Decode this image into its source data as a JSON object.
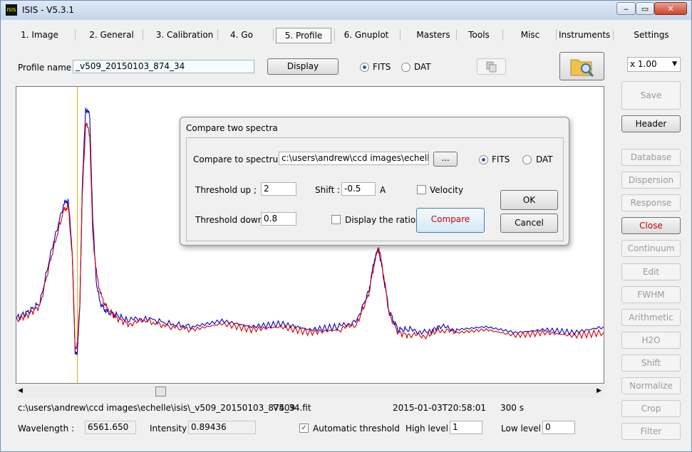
{
  "window": {
    "title": "ISIS - V5.3.1",
    "icon": "isis-app-icon",
    "icon_text": "ISIS",
    "minimize": "‒",
    "maximize": "▭",
    "close": "✕"
  },
  "tabs": [
    {
      "label": "1. Image"
    },
    {
      "label": "2. General"
    },
    {
      "label": "3. Calibration"
    },
    {
      "label": "4. Go"
    },
    {
      "label": "5. Profile"
    },
    {
      "label": "6. Gnuplot"
    },
    {
      "label": "Masters"
    },
    {
      "label": "Tools"
    },
    {
      "label": "Misc"
    },
    {
      "label": "Instruments"
    },
    {
      "label": "Settings"
    }
  ],
  "active_tab": "5. Profile",
  "profile": {
    "label": "Profile name :",
    "value": "_v509_20150103_874_34",
    "display_button": "Display",
    "fits_label": "FITS",
    "dat_label": "DAT",
    "format_selected": "FITS"
  },
  "zoom": {
    "value": "x 1.00",
    "arrow": "▼"
  },
  "right_buttons": [
    {
      "label": "Save",
      "enabled": false
    },
    {
      "label": "Header",
      "enabled": true
    },
    {
      "label": "Database",
      "enabled": false
    },
    {
      "label": "Dispersion",
      "enabled": false
    },
    {
      "label": "Response",
      "enabled": false
    },
    {
      "label": "Close",
      "enabled": true,
      "color": "#c00000"
    },
    {
      "label": "Continuum",
      "enabled": false
    },
    {
      "label": "Edit",
      "enabled": false
    },
    {
      "label": "FWHM",
      "enabled": false
    },
    {
      "label": "Arithmetic",
      "enabled": false
    },
    {
      "label": "H2O",
      "enabled": false
    },
    {
      "label": "Shift",
      "enabled": false
    },
    {
      "label": "Normalize",
      "enabled": false
    },
    {
      "label": "Crop",
      "enabled": false
    },
    {
      "label": "Filter",
      "enabled": false
    }
  ],
  "status": {
    "path": "c:\\users\\andrew\\ccd images\\echelle\\isis\\_v509_20150103_874_34.fit",
    "object": "V509",
    "date": "2015-01-03T20:58:01",
    "exposure": "300 s",
    "wavelength_label": "Wavelength :",
    "wavelength_value": "6561.650",
    "intensity_label": "Intensity :",
    "intensity_value": "0.89436",
    "auto_threshold_label": "Automatic threshold",
    "auto_threshold_checked": true,
    "high_level_label": "High level :",
    "high_level_value": "1",
    "low_level_label": "Low level :",
    "low_level_value": "0"
  },
  "scrollbar": {
    "left_arrow": "◀",
    "right_arrow": "▶",
    "position": 0.23
  },
  "dialog": {
    "title": "Compare two spectra",
    "compare_label": "Compare to spectrum :",
    "compare_value": "c:\\users\\andrew\\ccd images\\echelle\\isis\\_",
    "browse_label": "...",
    "fits_label": "FITS",
    "dat_label": "DAT",
    "format_selected": "FITS",
    "threshold_up_label": "Threshold up ;",
    "threshold_up_value": "2",
    "shift_label": "Shift :",
    "shift_value": "-0.5",
    "shift_unit": "A",
    "velocity_label": "Velocity",
    "velocity_checked": false,
    "threshold_down_label": "Threshold down :",
    "threshold_down_value": "0.8",
    "ratio_label": "Display the ratio",
    "ratio_checked": false,
    "compare_button": "Compare",
    "compare_color": "#d00000",
    "ok_button": "OK",
    "cancel_button": "Cancel"
  },
  "chart_data": {
    "type": "line",
    "cursor_x": 0.104,
    "ylim": [
      0,
      1
    ],
    "series": [
      {
        "color": "#0000c8",
        "x": [
          0,
          0.02,
          0.04,
          0.06,
          0.08,
          0.088,
          0.095,
          0.1,
          0.104,
          0.108,
          0.112,
          0.118,
          0.125,
          0.13,
          0.137,
          0.145,
          0.155,
          0.17,
          0.19,
          0.22,
          0.26,
          0.3,
          0.35,
          0.4,
          0.45,
          0.5,
          0.55,
          0.58,
          0.6,
          0.61,
          0.617,
          0.625,
          0.635,
          0.65,
          0.67,
          0.7,
          0.72,
          0.75,
          0.8,
          0.85,
          0.9,
          0.95,
          1.0
        ],
        "y": [
          0.22,
          0.24,
          0.27,
          0.45,
          0.6,
          0.62,
          0.45,
          0.1,
          0.11,
          0.25,
          0.65,
          0.93,
          0.9,
          0.55,
          0.32,
          0.26,
          0.24,
          0.23,
          0.21,
          0.22,
          0.2,
          0.19,
          0.21,
          0.19,
          0.2,
          0.18,
          0.19,
          0.21,
          0.31,
          0.42,
          0.45,
          0.36,
          0.24,
          0.18,
          0.18,
          0.17,
          0.19,
          0.18,
          0.19,
          0.17,
          0.18,
          0.17,
          0.19
        ]
      },
      {
        "color": "#d00000",
        "x": [
          0,
          0.02,
          0.04,
          0.06,
          0.08,
          0.088,
          0.095,
          0.1,
          0.104,
          0.108,
          0.112,
          0.118,
          0.125,
          0.13,
          0.137,
          0.145,
          0.155,
          0.17,
          0.19,
          0.22,
          0.26,
          0.3,
          0.35,
          0.4,
          0.45,
          0.5,
          0.55,
          0.58,
          0.6,
          0.61,
          0.617,
          0.625,
          0.635,
          0.65,
          0.67,
          0.7,
          0.72,
          0.75,
          0.8,
          0.85,
          0.9,
          0.95,
          1.0
        ],
        "y": [
          0.21,
          0.23,
          0.26,
          0.43,
          0.58,
          0.6,
          0.44,
          0.12,
          0.13,
          0.27,
          0.62,
          0.88,
          0.84,
          0.5,
          0.36,
          0.29,
          0.25,
          0.22,
          0.2,
          0.21,
          0.19,
          0.18,
          0.2,
          0.18,
          0.19,
          0.17,
          0.18,
          0.2,
          0.3,
          0.41,
          0.46,
          0.37,
          0.23,
          0.17,
          0.16,
          0.16,
          0.18,
          0.17,
          0.18,
          0.16,
          0.17,
          0.16,
          0.17
        ]
      }
    ]
  }
}
